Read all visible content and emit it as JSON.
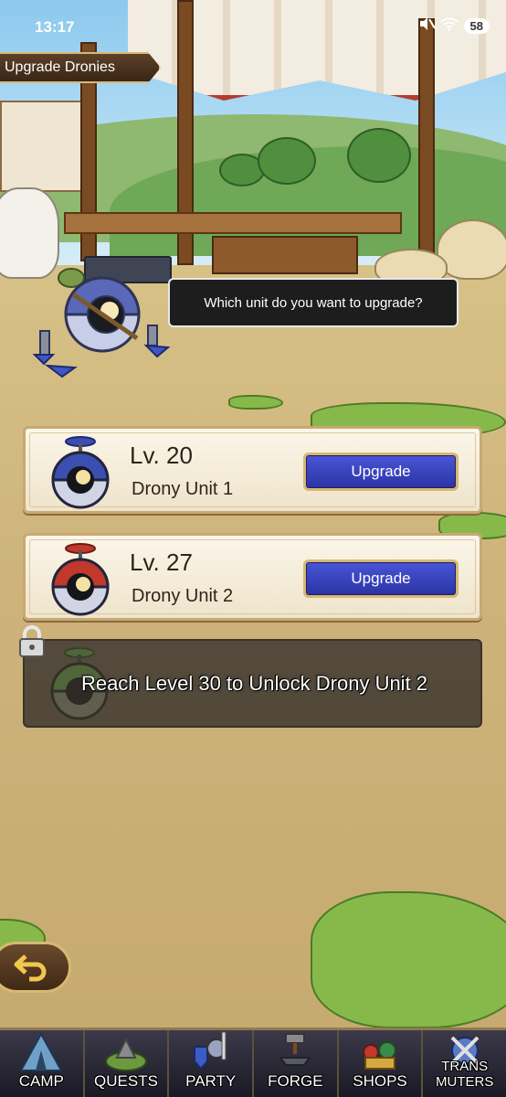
{
  "status_bar": {
    "time": "13:17",
    "battery": "58",
    "icons": [
      "mute-icon",
      "wifi-icon",
      "battery-icon"
    ]
  },
  "title": "Upgrade Dronies",
  "speech": "Which unit do you want to upgrade?",
  "units": [
    {
      "level": "Lv. 20",
      "name": "Drony Unit 1",
      "button": "Upgrade",
      "accent": "#3a4fb0"
    },
    {
      "level": "Lv. 27",
      "name": "Drony Unit 2",
      "button": "Upgrade",
      "accent": "#c0392b"
    }
  ],
  "locked_unit": {
    "message": "Reach Level 30 to Unlock Drony Unit 2",
    "accent": "#4e7d3a"
  },
  "nav": {
    "items": [
      {
        "label": "CAMP"
      },
      {
        "label": "QUESTS"
      },
      {
        "label": "PARTY"
      },
      {
        "label": "FORGE"
      },
      {
        "label": "SHOPS"
      },
      {
        "label": "TRANS\nMUTERS"
      }
    ]
  },
  "colors": {
    "button_blue": "#3a45c2",
    "gold_border": "#d7b873",
    "nav_bg": "#2a2836"
  }
}
